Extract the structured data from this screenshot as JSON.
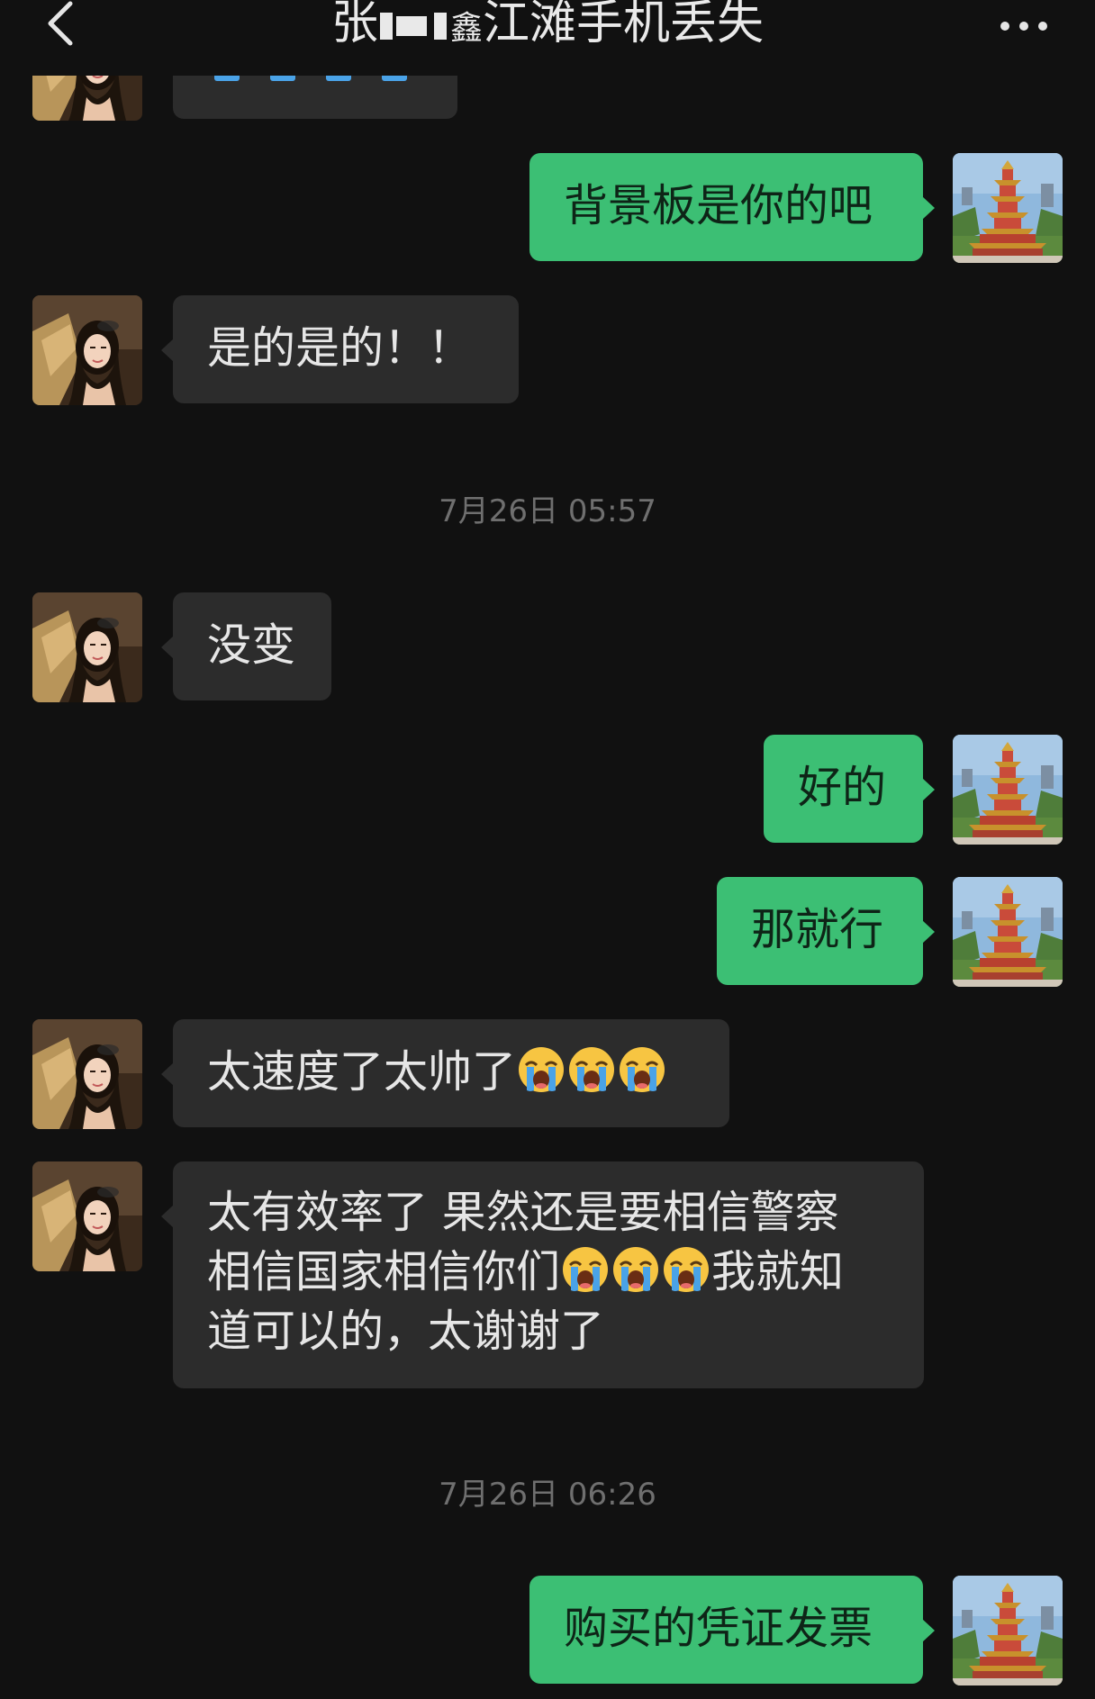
{
  "header": {
    "title_prefix": "张",
    "title_mid": "鑫",
    "title_suffix": "江滩手机丢失"
  },
  "messages": [
    {
      "side": "in",
      "text": "是的是的！！"
    },
    {
      "side": "out",
      "text": "背景板是你的吧"
    },
    {
      "side": "in",
      "text": "没变"
    },
    {
      "side": "out",
      "text": "好的"
    },
    {
      "side": "out",
      "text": "那就行"
    },
    {
      "side": "in",
      "text": "太速度了太帅了"
    },
    {
      "side": "in",
      "line1": "太有效率了 果然还是要相信警察",
      "line2a": "相信国家相信你们",
      "line2b": "我就知",
      "line3": "道可以的，太谢谢了"
    },
    {
      "side": "out",
      "text": "购买的凭证发票"
    }
  ],
  "timestamps": [
    "7月26日 05:57",
    "7月26日 06:26"
  ],
  "icons": {
    "back": "chevron-left-icon",
    "more": "more-dots-icon",
    "emoji": "loudly-crying-face-emoji"
  },
  "colors": {
    "background": "#111111",
    "incoming_bubble": "#2c2c2c",
    "outgoing_bubble": "#3cbf74",
    "timestamp": "#6f6f6f"
  }
}
